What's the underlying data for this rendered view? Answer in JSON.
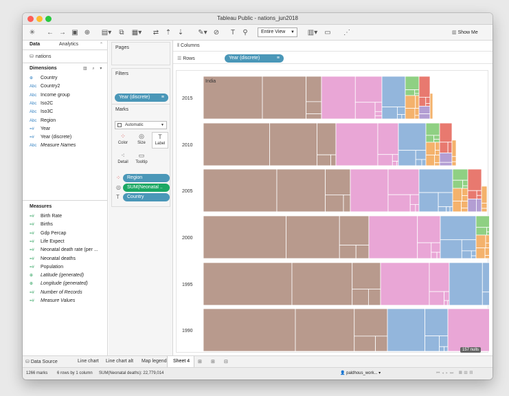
{
  "window": {
    "title": "Tableau Public - nations_jun2018"
  },
  "toolbar": {
    "fit_option": "Entire View",
    "show_me_label": "Show Me"
  },
  "data_pane": {
    "tab_data": "Data",
    "tab_analytics": "Analytics",
    "datasource_name": "nations",
    "dimensions_header": "Dimensions",
    "dimensions": [
      {
        "icon": "globe-icon",
        "type": "geo",
        "label": "Country"
      },
      {
        "icon": "abc-icon",
        "type": "abc",
        "label": "Country2"
      },
      {
        "icon": "abc-icon",
        "type": "abc",
        "label": "Income group"
      },
      {
        "icon": "abc-icon",
        "type": "abc",
        "label": "Iso2C"
      },
      {
        "icon": "abc-icon",
        "type": "abc",
        "label": "Iso3C"
      },
      {
        "icon": "abc-icon",
        "type": "abc",
        "label": "Region"
      },
      {
        "icon": "number-icon",
        "type": "num",
        "label": "Year"
      },
      {
        "icon": "number-icon",
        "type": "num",
        "label": "Year (discrete)"
      },
      {
        "icon": "abc-icon",
        "type": "abc",
        "label": "Measure Names"
      }
    ],
    "measures_header": "Measures",
    "measures": [
      {
        "icon": "number-icon",
        "type": "num",
        "label": "Birth Rate"
      },
      {
        "icon": "number-icon",
        "type": "num",
        "label": "Births"
      },
      {
        "icon": "number-icon",
        "type": "num",
        "label": "Gdp Percap"
      },
      {
        "icon": "number-icon",
        "type": "num",
        "label": "Life Expect"
      },
      {
        "icon": "number-icon",
        "type": "num",
        "label": "Neonatal death rate (per ..."
      },
      {
        "icon": "number-icon",
        "type": "num",
        "label": "Neonatal deaths"
      },
      {
        "icon": "number-icon",
        "type": "num",
        "label": "Population"
      },
      {
        "icon": "globe-icon",
        "type": "geo",
        "label": "Latitude (generated)"
      },
      {
        "icon": "globe-icon",
        "type": "geo",
        "label": "Longitude (generated)"
      },
      {
        "icon": "number-icon",
        "type": "num",
        "label": "Number of Records"
      },
      {
        "icon": "number-icon",
        "type": "num",
        "label": "Measure Values"
      }
    ]
  },
  "shelves": {
    "pages_title": "Pages",
    "filters_title": "Filters",
    "filter_pill": "Year (discrete)",
    "marks_title": "Marks",
    "mark_type": "Automatic",
    "mark_buttons": [
      "Color",
      "Size",
      "Label",
      "Detail",
      "Tooltip"
    ],
    "mark_pills": [
      {
        "icon": "color-dots-icon",
        "label": "Region",
        "kind": "dimension"
      },
      {
        "icon": "size-icon",
        "label": "SUM(Neonatal ..",
        "kind": "measure"
      },
      {
        "icon": "label-icon",
        "label": "Country",
        "kind": "dimension"
      }
    ],
    "columns_label": "Columns",
    "rows_label": "Rows",
    "rows_pill": "Year (discrete)"
  },
  "viz": {
    "first_tile_label": "India",
    "years": [
      "2015",
      "2010",
      "2005",
      "2000",
      "1995",
      "1990"
    ],
    "nulls_badge": "157 nulls",
    "region_colors": {
      "South Asia": "#b89a8d",
      "Sub-Saharan Africa": "#e9a6d6",
      "East Asia & Pacific": "#93b6dc",
      "Middle East & North Africa": "#e8796f",
      "Latin America & Caribbean": "#8fd083",
      "Europe & Central Asia": "#f4b26c",
      "North America": "#b39ed3"
    }
  },
  "sheet_tabs": [
    "Data Source",
    "Line chart",
    "Line chart alt",
    "Map legend",
    "Sheet 4"
  ],
  "active_sheet": "Sheet 4",
  "status": {
    "marks": "1266 marks",
    "rows_cols": "6 rows by 1 column",
    "sum": "SUM(Neonatal deaths): 22,779,014",
    "user": "paldhous_work..."
  }
}
